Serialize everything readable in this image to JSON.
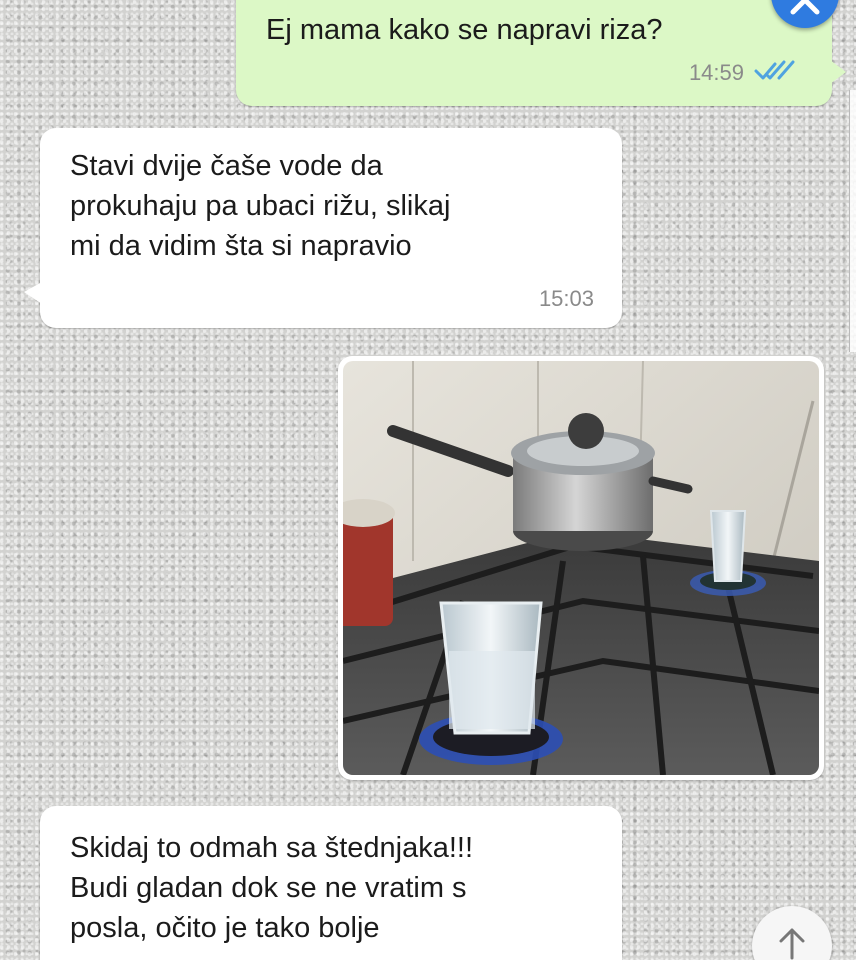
{
  "messages": [
    {
      "direction": "outgoing",
      "text": "Ej mama kako se napravi riza?",
      "time": "14:59",
      "status_icon": "double-check-icon"
    },
    {
      "direction": "incoming",
      "text": "Stavi dvije čaše vode da\nprokuhaju pa ubaci rižu, slikaj\nmi da vidim šta si napravio",
      "time": "15:03"
    },
    {
      "direction": "outgoing",
      "type": "photo",
      "image_description_icon": "photo-icon"
    },
    {
      "direction": "incoming",
      "text": "Skidaj to odmah sa štednjaka!!!\nBudi gladan dok se ne vratim s\nposla, očito je tako bolje"
    }
  ],
  "controls": {
    "close_icon": "close-icon",
    "scroll_icon": "arrow-up-icon"
  },
  "colors": {
    "outgoing_bubble": "#dcf8c6",
    "incoming_bubble": "#ffffff",
    "read_ticks": "#4fa3e0",
    "close_button": "#2f7be0"
  }
}
